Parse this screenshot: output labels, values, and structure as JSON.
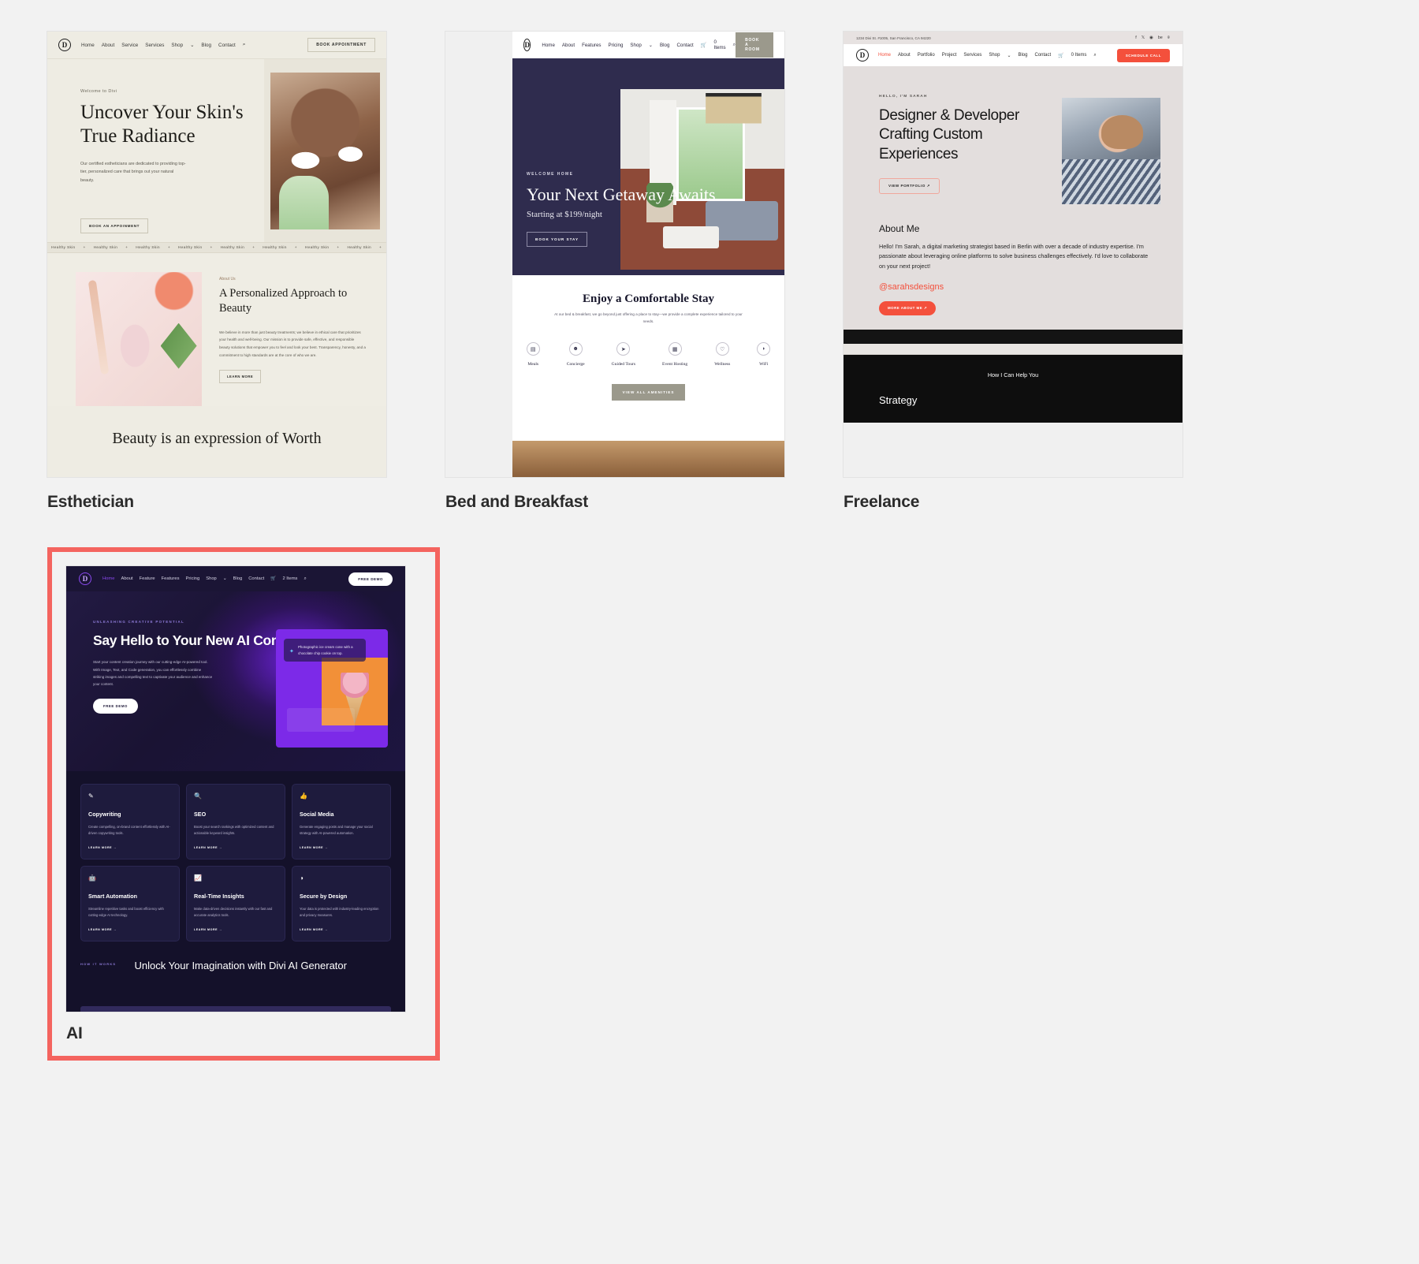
{
  "gallery": {
    "cards": [
      {
        "label": "Esthetician"
      },
      {
        "label": "Bed and Breakfast"
      },
      {
        "label": "Freelance"
      },
      {
        "label": "AI",
        "selected": true,
        "highlight_color": "#f4645f"
      }
    ]
  },
  "esthetician": {
    "logo": "D",
    "menu": [
      "Home",
      "About",
      "Service",
      "Services",
      "Shop",
      "Blog",
      "Contact"
    ],
    "shop_caret": "⌄",
    "search_icon": "search-icon",
    "cta": "BOOK APPOINTMENT",
    "hero": {
      "eyebrow": "Welcome to Divi",
      "title": "Uncover Your Skin's True Radiance",
      "paragraph": "Our certified estheticians are dedicated to providing top-tier, personalized care that brings out your natural beauty.",
      "button": "BOOK AN APPOINMENT"
    },
    "marquee_item": "Healthy Skin",
    "marquee_sep": "+",
    "about": {
      "eyebrow": "About Us",
      "title": "A Personalized Approach to Beauty",
      "paragraph": "We believe in more than just beauty treatments; we believe in ethical care that prioritizes your health and well-being. Our mission is to provide safe, effective, and responsible beauty solutions that empower you to feel and look your best. Transparency, honesty, and a commitment to high standards are at the core of who we are.",
      "button": "LEARN MORE"
    },
    "bottom_title": "Beauty is an expression of Worth"
  },
  "bnb": {
    "logo": "D",
    "menu": [
      "Home",
      "About",
      "Features",
      "Pricing",
      "Shop",
      "Blog",
      "Contact"
    ],
    "cart": "0 Items",
    "cart_icon": "cart-icon",
    "search_icon": "search-icon",
    "cta": "BOOK A ROOM",
    "hero": {
      "eyebrow": "WELCOME HOME",
      "title": "Your Next Getaway Awaits",
      "subtitle": "Starting at $199/night",
      "button": "BOOK YOUR STAY"
    },
    "section": {
      "title": "Enjoy a Comfortable Stay",
      "paragraph": "At our bed & breakfast, we go beyond just offering a place to stay—we provide a complete experience tailored to your needs.",
      "amenities": [
        {
          "label": "Meals",
          "icon": "meal-icon",
          "glyph": "▤"
        },
        {
          "label": "Concierge",
          "icon": "concierge-icon",
          "glyph": "☻"
        },
        {
          "label": "Guided Tours",
          "icon": "tour-icon",
          "glyph": "➤"
        },
        {
          "label": "Event Hosting",
          "icon": "event-icon",
          "glyph": "▦"
        },
        {
          "label": "Wellness",
          "icon": "wellness-icon",
          "glyph": "♡"
        },
        {
          "label": "WiFi",
          "icon": "wifi-icon",
          "glyph": "◗"
        }
      ],
      "button": "VIEW ALL AMENITIES"
    }
  },
  "freelance": {
    "address": "1234 Divi St. #1005, San Francisco, CA 94220",
    "social": [
      "f",
      "𝕏",
      "◉",
      "be",
      "⌾"
    ],
    "logo": "D",
    "menu": [
      "Home",
      "About",
      "Portfolio",
      "Project",
      "Services",
      "Shop",
      "Blog",
      "Contact"
    ],
    "cart": "0 Items",
    "search_icon": "search-icon",
    "cta": "SCHEDULE CALL",
    "hero": {
      "eyebrow": "HELLO, I'M SARAH",
      "title": "Designer & Developer Crafting Custom Experiences",
      "button": "VIEW PORTFOLIO ↗"
    },
    "about": {
      "title": "About Me",
      "paragraph": "Hello! I'm Sarah, a digital marketing strategist based in Berlin with over a decade of industry expertise. I'm passionate about leveraging online platforms to solve business challenges effectively. I'd love to collaborate on your next project!",
      "handle": "@sarahsdesigns",
      "button": "MORE ABOUT ME ↗"
    },
    "help_title": "How I Can Help You",
    "help_sub": "Strategy"
  },
  "ai": {
    "logo": "D",
    "menu": [
      "Home",
      "About",
      "Feature",
      "Features",
      "Pricing",
      "Shop",
      "Blog",
      "Contact"
    ],
    "cart": "2 Items",
    "cart_icon": "cart-icon",
    "search_icon": "search-icon",
    "cta": "FREE DEMO",
    "hero": {
      "eyebrow": "UNLEASHING CREATIVE POTENTIAL",
      "title": "Say Hello to Your New AI Companion",
      "paragraph": "Start your content creation journey with our cutting-edge AI-powered tool. With Image, Text, and Code generation, you can effortlessly combine striking images and compelling text to captivate your audience and enhance your content.",
      "button": "FREE DEMO",
      "tooltip": "Photographic ice cream cone with a chocolate chip cookie on top.",
      "sparkle_icon": "sparkle-icon"
    },
    "features": [
      {
        "title": "Copywriting",
        "icon": "feather-icon",
        "glyph": "✎",
        "desc": "Create compelling, on-brand content effortlessly with AI-driven copywriting tools.",
        "link": "LEARN MORE →"
      },
      {
        "title": "SEO",
        "icon": "magnifier-icon",
        "glyph": "🔍",
        "desc": "Boost your search rankings with optimized content and actionable keyword insights.",
        "link": "LEARN MORE →"
      },
      {
        "title": "Social Media",
        "icon": "thumbs-up-icon",
        "glyph": "👍",
        "desc": "Generate engaging posts and manage your social strategy with AI-powered automation.",
        "link": "LEARN MORE →"
      },
      {
        "title": "Smart Automation",
        "icon": "robot-icon",
        "glyph": "🤖",
        "desc": "Streamline repetitive tasks and boost efficiency with cutting-edge AI technology.",
        "link": "LEARN MORE →"
      },
      {
        "title": "Real-Time Insights",
        "icon": "chart-icon",
        "glyph": "📈",
        "desc": "Make data-driven decisions instantly with our fast and accurate analytics tools.",
        "link": "LEARN MORE →"
      },
      {
        "title": "Secure by Design",
        "icon": "shield-icon",
        "glyph": "◑",
        "desc": "Your data is protected with industry-leading encryption and privacy measures.",
        "link": "LEARN MORE →"
      }
    ],
    "footer": {
      "eyebrow": "HOW IT WORKS",
      "title": "Unlock Your Imagination with Divi AI Generator"
    }
  }
}
